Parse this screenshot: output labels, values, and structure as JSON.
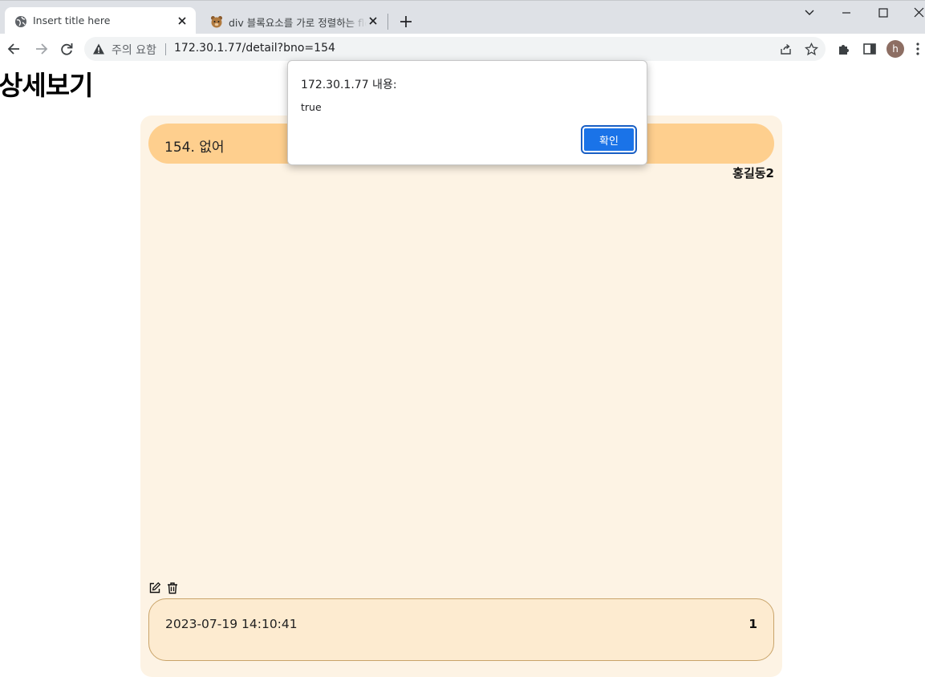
{
  "browser": {
    "tabs": [
      {
        "title": "Insert title here",
        "active": true
      },
      {
        "title": "div 블록요소를 가로 정렬하는 fle",
        "active": false
      }
    ],
    "address": {
      "security_label": "주의 요함",
      "url": "172.30.1.77/detail?bno=154"
    },
    "profile_initial": "h"
  },
  "page": {
    "heading": "상세보기",
    "post": {
      "title": "154. 없어",
      "author": "홍길동2",
      "date": "2023-07-19 14:10:41",
      "count": "1"
    }
  },
  "dialog": {
    "title": "172.30.1.77 내용:",
    "message": "true",
    "ok_label": "확인"
  },
  "colors": {
    "card_bg": "#fdf3e4",
    "title_bar": "#fecf8e",
    "footer_bar": "#fdebd0",
    "accent_button": "#1a73e8"
  }
}
